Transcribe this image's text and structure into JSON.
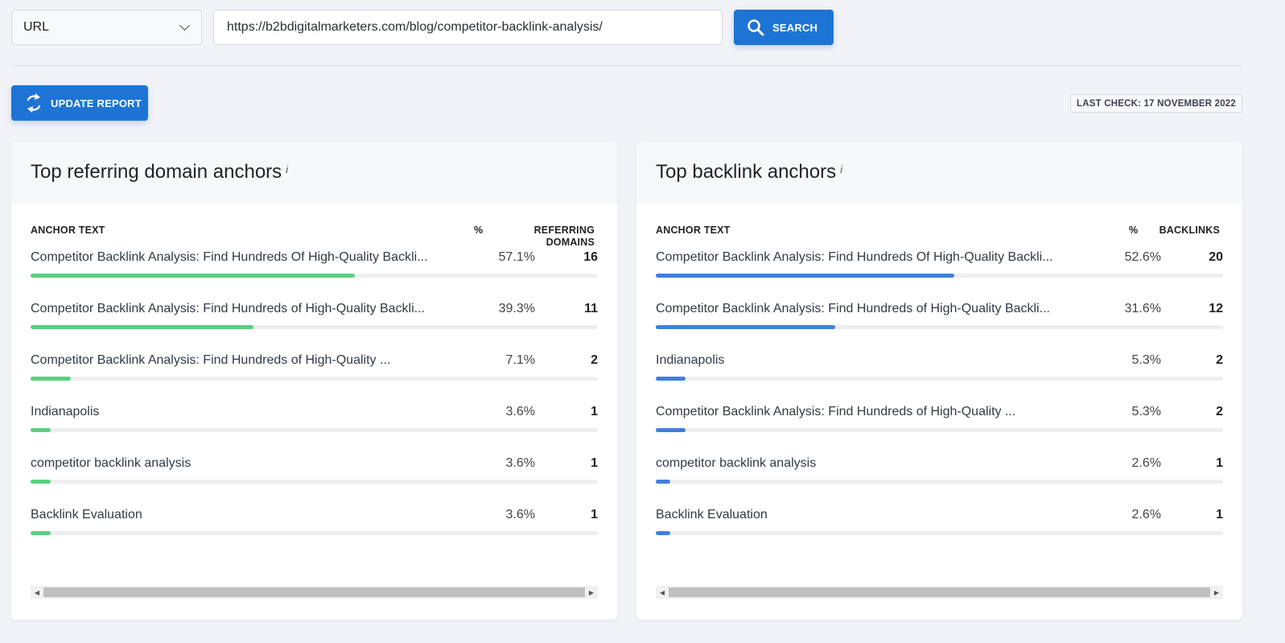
{
  "search": {
    "type_selected": "URL",
    "url_value": "https://b2bdigitalmarketers.com/blog/competitor-backlink-analysis/",
    "search_label": "SEARCH"
  },
  "toolbar": {
    "update_label": "UPDATE REPORT",
    "last_check": "LAST CHECK: 17 NOVEMBER 2022"
  },
  "panels": [
    {
      "title": "Top referring domain anchors",
      "info": "i",
      "color": "#5ccf7f",
      "columns": {
        "anchor": "ANCHOR TEXT",
        "pct": "%",
        "count_line1": "REFERRING",
        "count_line2": "DOMAINS"
      },
      "rows": [
        {
          "anchor": "Competitor Backlink Analysis: Find Hundreds Of High-Quality Backli...",
          "pct": "57.1%",
          "pct_value": 57.1,
          "count": "16"
        },
        {
          "anchor": "Competitor Backlink Analysis: Find Hundreds of High-Quality Backli...",
          "pct": "39.3%",
          "pct_value": 39.3,
          "count": "11"
        },
        {
          "anchor": "Competitor Backlink Analysis: Find Hundreds of High-Quality ...",
          "pct": "7.1%",
          "pct_value": 7.1,
          "count": "2"
        },
        {
          "anchor": "Indianapolis",
          "pct": "3.6%",
          "pct_value": 3.6,
          "count": "1"
        },
        {
          "anchor": "competitor backlink analysis",
          "pct": "3.6%",
          "pct_value": 3.6,
          "count": "1"
        },
        {
          "anchor": "Backlink Evaluation",
          "pct": "3.6%",
          "pct_value": 3.6,
          "count": "1"
        }
      ]
    },
    {
      "title": "Top backlink anchors",
      "info": "i",
      "color": "#3f7fe0",
      "columns": {
        "anchor": "ANCHOR TEXT",
        "pct": "%",
        "count_line1": "BACKLINKS",
        "count_line2": ""
      },
      "rows": [
        {
          "anchor": "Competitor Backlink Analysis: Find Hundreds Of High-Quality Backli...",
          "pct": "52.6%",
          "pct_value": 52.6,
          "count": "20"
        },
        {
          "anchor": "Competitor Backlink Analysis: Find Hundreds of High-Quality Backli...",
          "pct": "31.6%",
          "pct_value": 31.6,
          "count": "12"
        },
        {
          "anchor": "Indianapolis",
          "pct": "5.3%",
          "pct_value": 5.3,
          "count": "2"
        },
        {
          "anchor": "Competitor Backlink Analysis: Find Hundreds of High-Quality ...",
          "pct": "5.3%",
          "pct_value": 5.3,
          "count": "2"
        },
        {
          "anchor": "competitor backlink analysis",
          "pct": "2.6%",
          "pct_value": 2.6,
          "count": "1"
        },
        {
          "anchor": "Backlink Evaluation",
          "pct": "2.6%",
          "pct_value": 2.6,
          "count": "1"
        }
      ]
    }
  ]
}
